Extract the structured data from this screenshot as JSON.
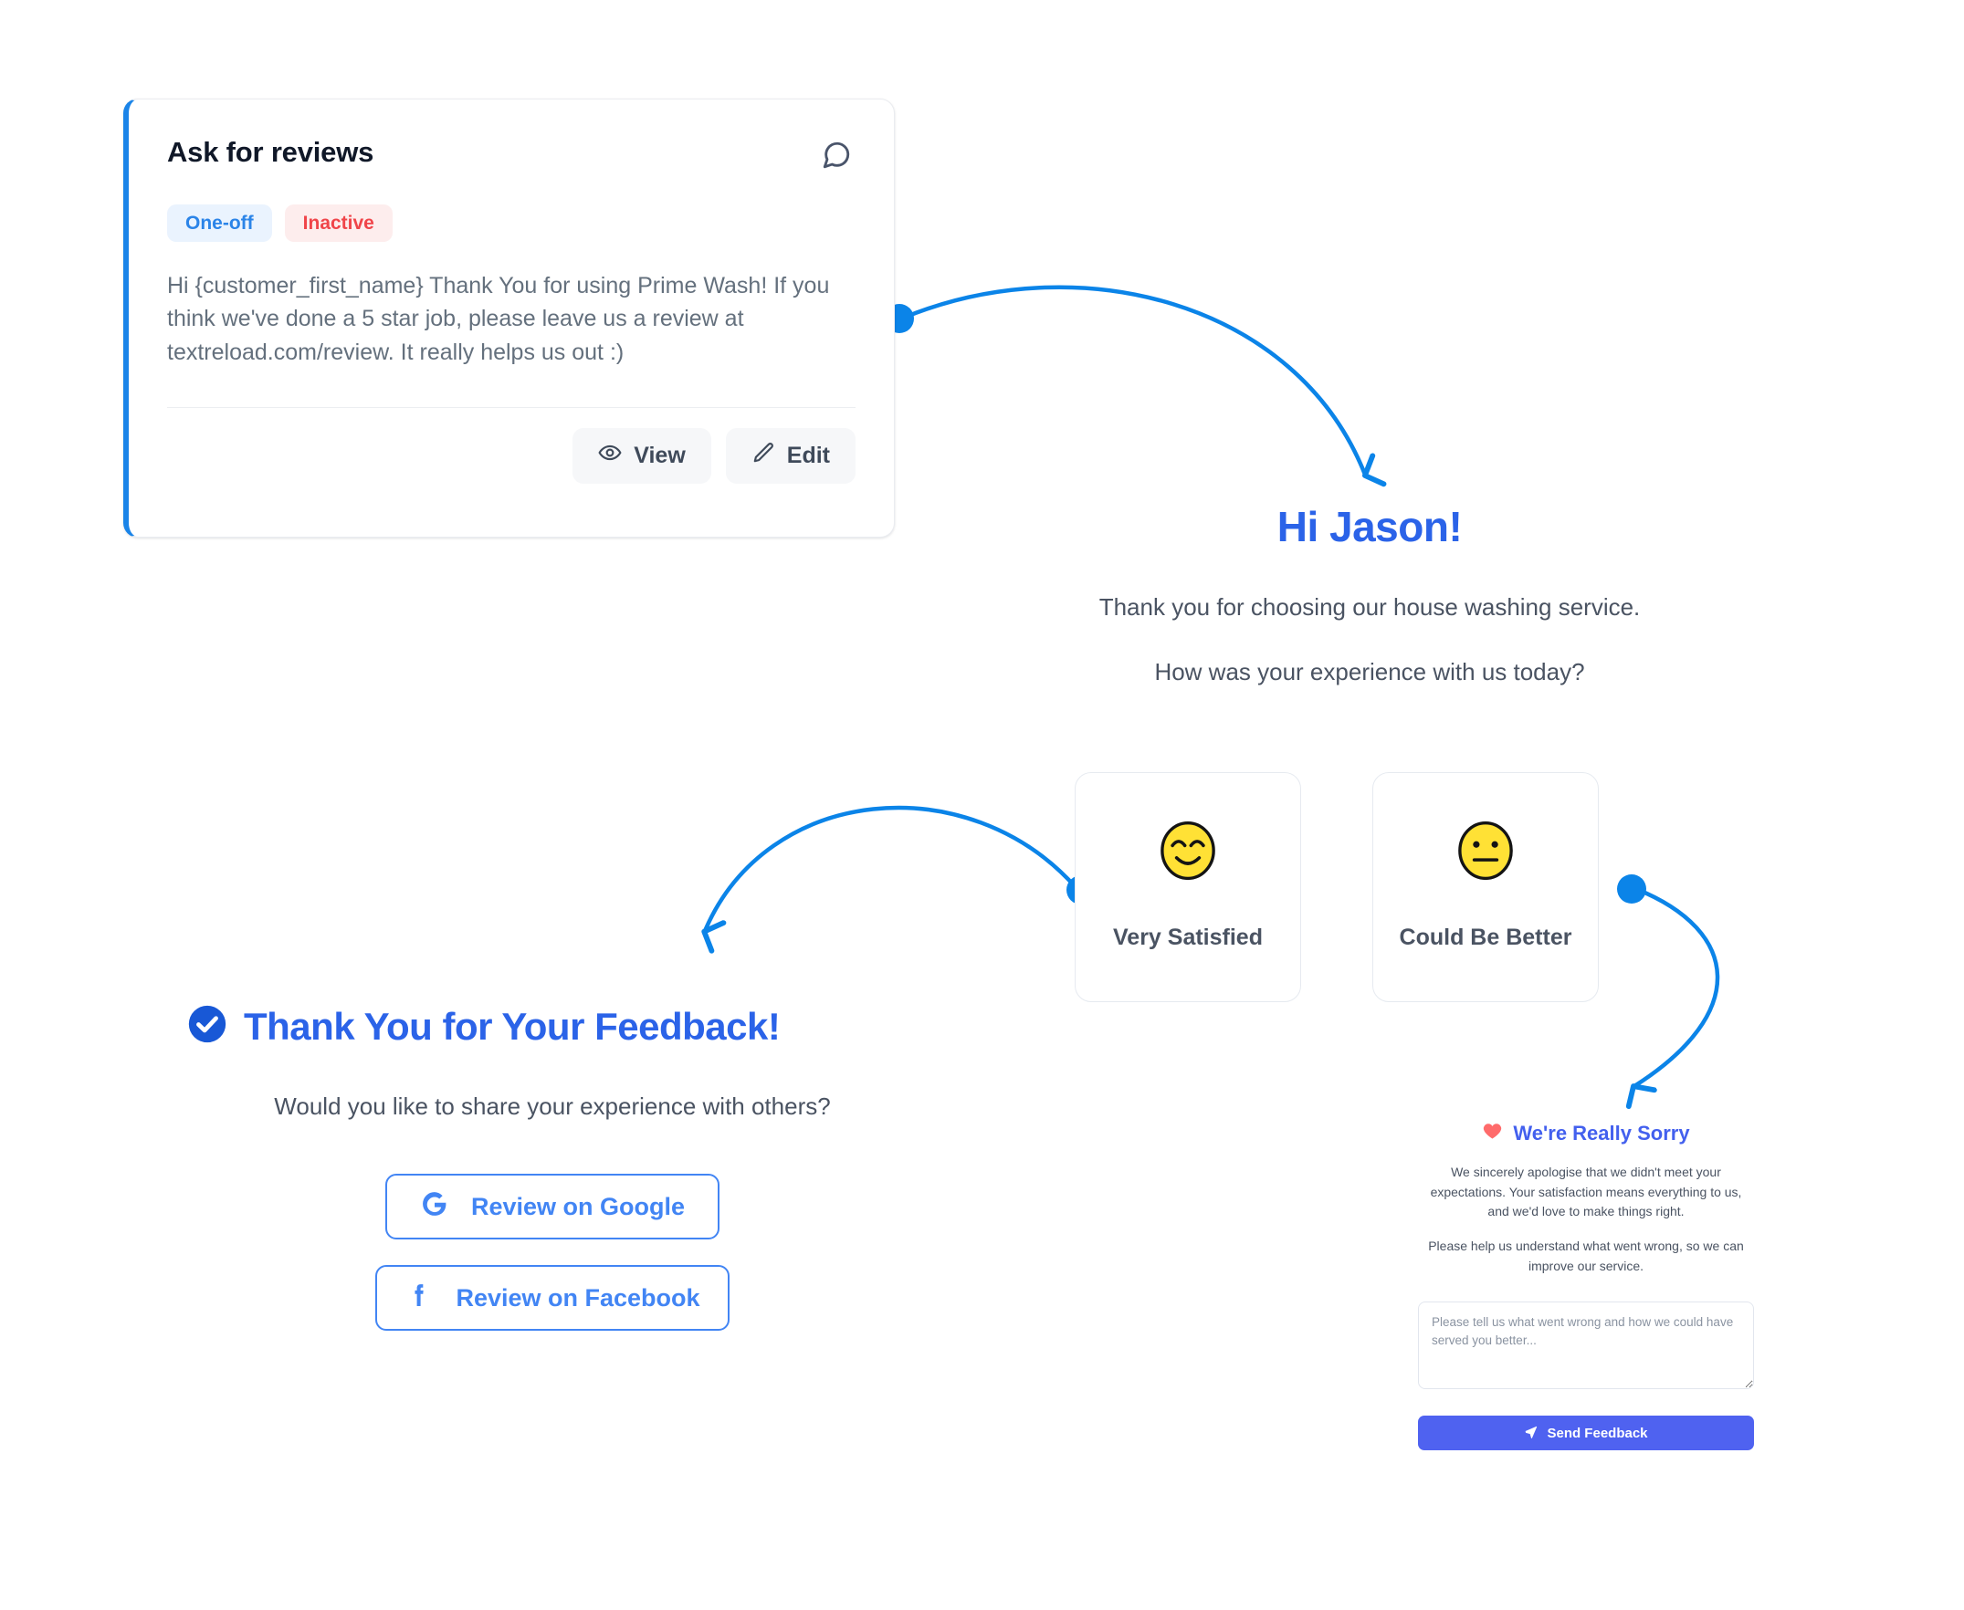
{
  "campaign_card": {
    "title": "Ask for reviews",
    "header_icon": "message-bubble-icon",
    "badges": [
      {
        "label": "One-off",
        "kind": "type"
      },
      {
        "label": "Inactive",
        "kind": "status"
      }
    ],
    "message": "Hi {customer_first_name} Thank You for using Prime Wash! If you think we've done a 5 star job, please leave us a review at textreload.com/review. It really helps us out :)",
    "actions": [
      {
        "label": "View",
        "icon": "eye-icon"
      },
      {
        "label": "Edit",
        "icon": "pencil-icon"
      }
    ]
  },
  "greeting": {
    "title": "Hi Jason!",
    "line1": "Thank you for choosing our house washing service.",
    "line2": "How was your experience with us today?"
  },
  "mood_options": [
    {
      "label": "Very Satisfied",
      "emoji": "smiling-face-with-smiling-eyes-icon"
    },
    {
      "label": "Could Be Better",
      "emoji": "neutral-face-icon"
    }
  ],
  "thanks": {
    "icon": "check-circle-icon",
    "title": "Thank You for Your Feedback!",
    "subtitle": "Would you like to share your experience with others?",
    "share_buttons": [
      {
        "label": "Review on Google",
        "icon": "google-g-icon"
      },
      {
        "label": "Review on Facebook",
        "icon": "facebook-f-icon"
      }
    ]
  },
  "sorry": {
    "icon": "heart-icon",
    "title": "We're Really Sorry",
    "paragraph1": "We sincerely apologise that we didn't meet your expectations. Your satisfaction means everything to us, and we'd love to make things right.",
    "paragraph2": "Please help us understand what went wrong, so we can improve our service.",
    "textarea_placeholder": "Please tell us what went wrong and how we could have served you better...",
    "textarea_value": "",
    "send_label": "Send Feedback",
    "send_icon": "paper-plane-icon"
  },
  "colors": {
    "accent_blue": "#2b63e8",
    "connector_blue": "#0b84e8",
    "card_accent": "#1a84e8",
    "badge_oneoff_text": "#2b84e8",
    "badge_inactive_text": "#f0454a",
    "google_blue": "#4285f4",
    "send_violet": "#4f62f0",
    "heart_red": "#ff6b6b",
    "emoji_yellow": "#ffe135"
  }
}
